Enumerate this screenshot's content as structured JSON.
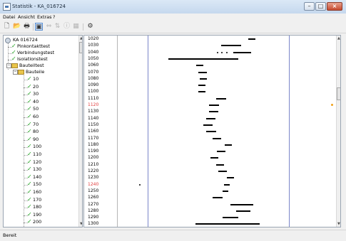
{
  "window": {
    "title": "Statistik - KA_016724",
    "buttons": {
      "minimize": "–",
      "maximize": "□",
      "close": "×"
    }
  },
  "menu": [
    {
      "label": "Datei"
    },
    {
      "label": "Ansicht"
    },
    {
      "label": "Extras"
    },
    {
      "label": "?"
    }
  ],
  "toolbar": {
    "icons": [
      "new-icon",
      "open-icon",
      "print-icon",
      "view-icon",
      "move-icon",
      "align-icon",
      "info-icon",
      "grid-icon",
      "settings-icon"
    ],
    "glyphs": [
      "🗋",
      "📂",
      "🖶",
      "▣",
      "⇔",
      "⇅",
      "ⓘ",
      "▦",
      "⚙"
    ]
  },
  "tree": {
    "root": "KA 016724",
    "items": [
      {
        "label": "Pinkontakttest",
        "type": "check"
      },
      {
        "label": "Verbindungstest",
        "type": "check"
      },
      {
        "label": "Isolationstest",
        "type": "check"
      },
      {
        "label": "Bauteiltest",
        "type": "folder"
      },
      {
        "label": "Bauteile",
        "type": "folder"
      }
    ],
    "parts": [
      "10",
      "20",
      "30",
      "40",
      "50",
      "60",
      "70",
      "80",
      "90",
      "100",
      "110",
      "120",
      "130",
      "140",
      "150",
      "160",
      "170",
      "180",
      "190",
      "200"
    ]
  },
  "rows": [
    {
      "label": "1020",
      "red": false
    },
    {
      "label": "1030",
      "red": false
    },
    {
      "label": "1040",
      "red": false
    },
    {
      "label": "1050",
      "red": false
    },
    {
      "label": "1060",
      "red": false
    },
    {
      "label": "1070",
      "red": false
    },
    {
      "label": "1080",
      "red": false
    },
    {
      "label": "1090",
      "red": false
    },
    {
      "label": "1100",
      "red": false
    },
    {
      "label": "1110",
      "red": false
    },
    {
      "label": "1120",
      "red": true
    },
    {
      "label": "1130",
      "red": false
    },
    {
      "label": "1140",
      "red": false
    },
    {
      "label": "1150",
      "red": false
    },
    {
      "label": "1160",
      "red": false
    },
    {
      "label": "1170",
      "red": false
    },
    {
      "label": "1180",
      "red": false
    },
    {
      "label": "1190",
      "red": false
    },
    {
      "label": "1200",
      "red": false
    },
    {
      "label": "1210",
      "red": false
    },
    {
      "label": "1220",
      "red": false
    },
    {
      "label": "1230",
      "red": false
    },
    {
      "label": "1240",
      "red": true
    },
    {
      "label": "1250",
      "red": false
    },
    {
      "label": "1260",
      "red": false
    },
    {
      "label": "1270",
      "red": false
    },
    {
      "label": "1280",
      "red": false
    },
    {
      "label": "1290",
      "red": false
    },
    {
      "label": "1300",
      "red": false
    }
  ],
  "status": "Bereit",
  "colors": {
    "reference_line": "#7a86c9",
    "highlight_label": "#e23a3a",
    "indicator": "#f0a21b"
  }
}
